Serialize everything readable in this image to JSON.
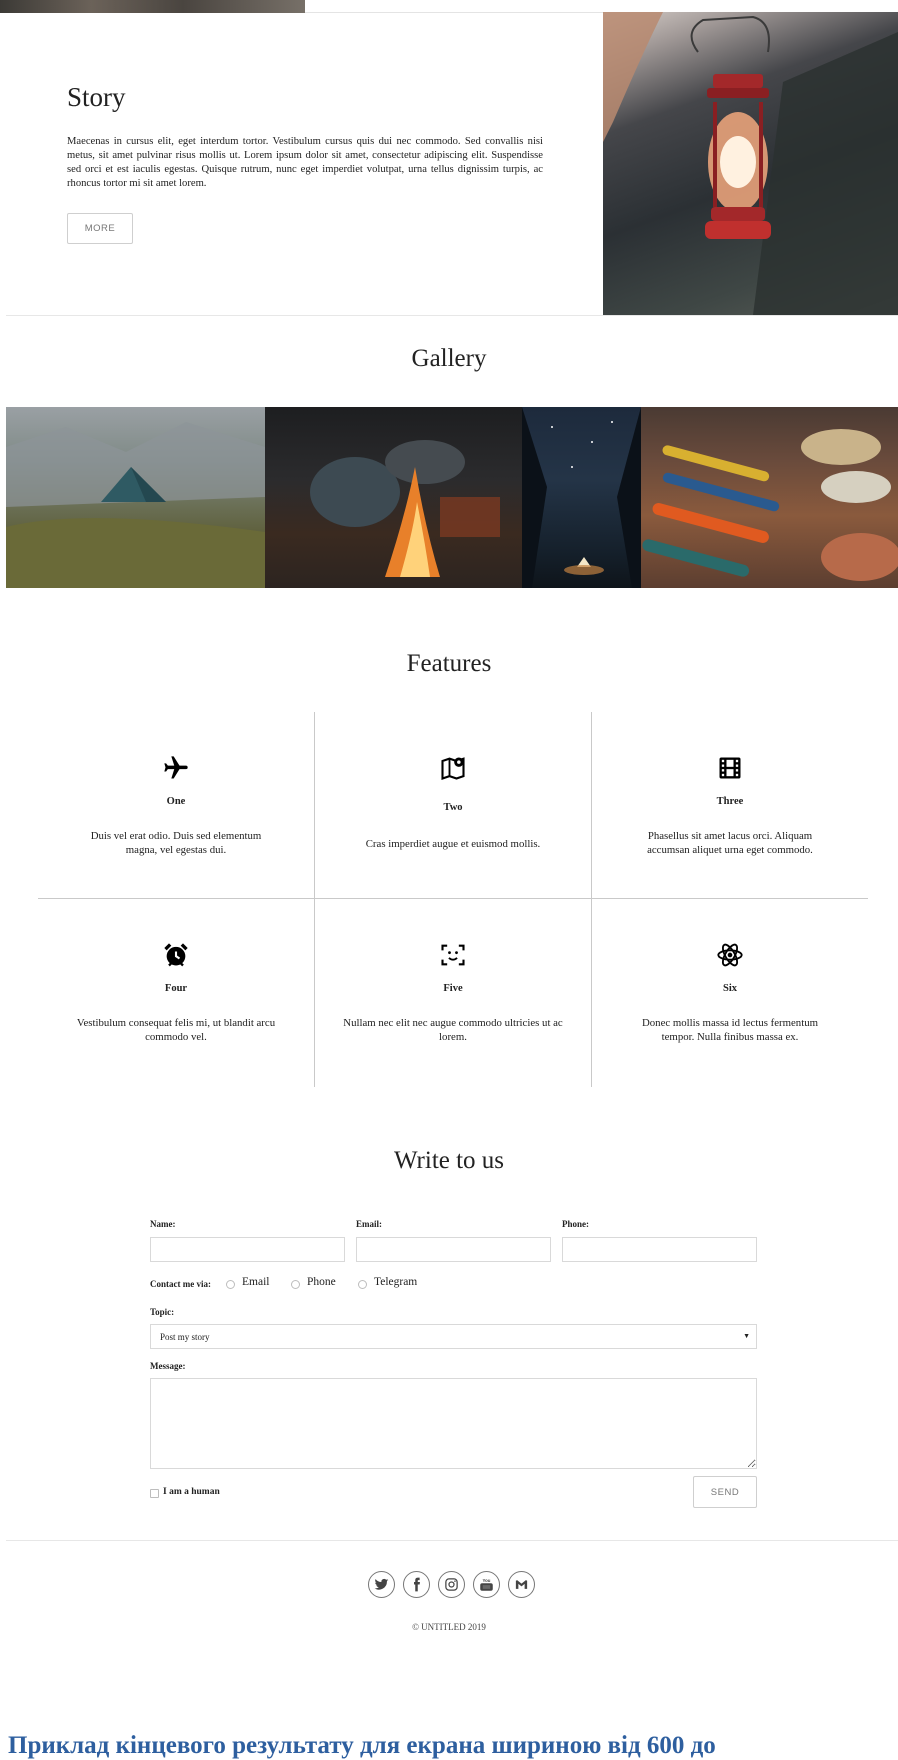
{
  "story": {
    "title": "Story",
    "text": "Maecenas in cursus elit, eget interdum tortor. Vestibulum cursus quis dui nec commodo. Sed convallis nisi metus, sit amet pulvinar risus mollis ut. Lorem ipsum dolor sit amet, consectetur adipiscing elit. Suspendisse sed orci et est iaculis egestas. Quisque rutrum, nunc eget imperdiet volutpat, urna tellus dignissim turpis, ac rhoncus tortor mi sit amet lorem.",
    "more_label": "MORE"
  },
  "gallery": {
    "title": "Gallery"
  },
  "features": {
    "title": "Features",
    "items": [
      {
        "name": "One",
        "text": "Duis vel erat odio. Duis sed elementum magna, vel egestas dui.",
        "icon": "airplane-icon"
      },
      {
        "name": "Two",
        "text": "Cras imperdiet augue et euismod mollis.",
        "icon": "map-pin-icon"
      },
      {
        "name": "Three",
        "text": "Phasellus sit amet lacus orci. Aliquam accumsan aliquet urna eget commodo.",
        "icon": "film-icon"
      },
      {
        "name": "Four",
        "text": "Vestibulum consequat felis mi, ut blandit arcu commodo vel.",
        "icon": "alarm-clock-icon"
      },
      {
        "name": "Five",
        "text": "Nullam nec elit nec augue commodo ultricies ut ac lorem.",
        "icon": "face-scan-icon"
      },
      {
        "name": "Six",
        "text": "Donec mollis massa id lectus fermentum tempor. Nulla finibus massa ex.",
        "icon": "atom-icon"
      }
    ]
  },
  "contact": {
    "title": "Write to us",
    "name_label": "Name:",
    "email_label": "Email:",
    "phone_label": "Phone:",
    "contact_via_label": "Contact me via:",
    "via_options": [
      "Email",
      "Phone",
      "Telegram"
    ],
    "topic_label": "Topic:",
    "topic_value": "Post my story",
    "message_label": "Message:",
    "human_label": "I am a human",
    "send_label": "SEND"
  },
  "footer": {
    "social": [
      "twitter-icon",
      "facebook-icon",
      "instagram-icon",
      "youtube-icon",
      "gmail-icon"
    ],
    "copyright": "© UNTITLED 2019"
  },
  "caption": "Приклад кінцевого результату для екрана шириною від 600 до"
}
